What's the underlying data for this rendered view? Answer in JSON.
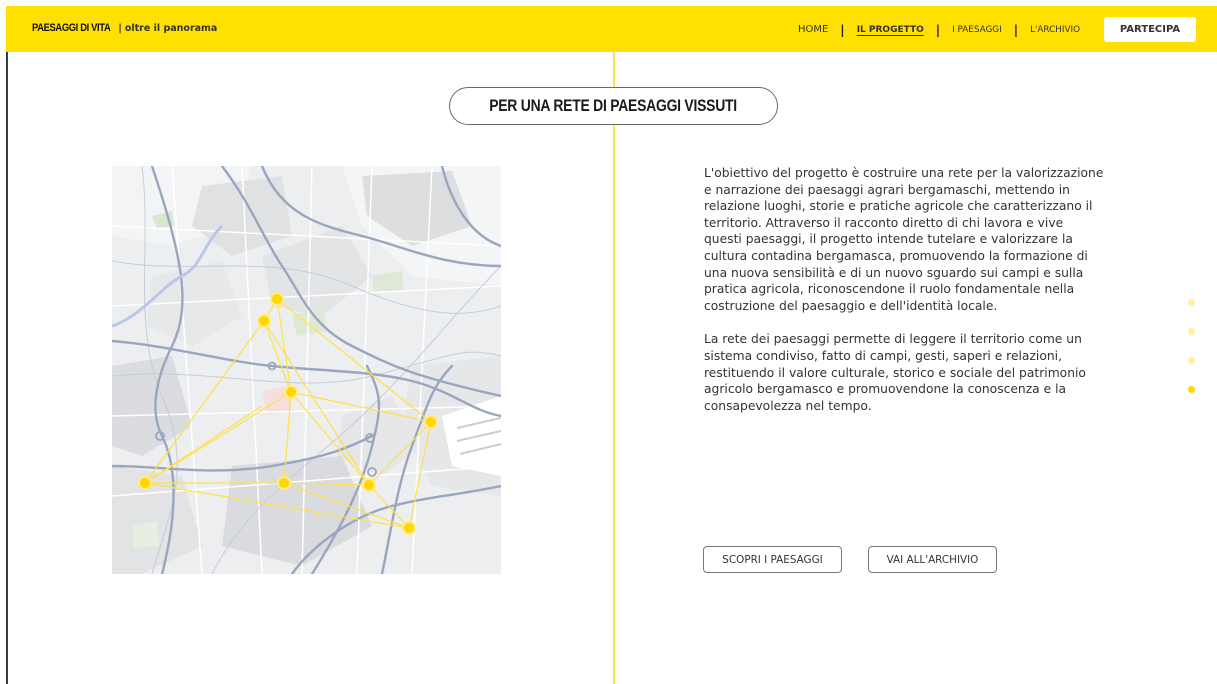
{
  "header": {
    "brand_name": "PAESAGGI DI VITA",
    "brand_separator": "|",
    "brand_tagline": "oltre il panorama",
    "nav": [
      {
        "label": "HOME"
      },
      {
        "label": "IL PROGETTO"
      },
      {
        "label": "I PAESAGGI"
      },
      {
        "label": "L'ARCHIVIO"
      }
    ],
    "nav_separator": "|",
    "cta_label": "PARTECIPA"
  },
  "section": {
    "title": "PER UNA RETE DI PAESAGGI VISSUTI",
    "paragraphs": [
      "L'obiettivo del progetto è costruire una rete per la valorizzazione e narrazione dei paesaggi agrari bergamaschi, mettendo in relazione luoghi, storie e pratiche agricole che caratterizzano il territorio. Attraverso il racconto diretto di chi lavora e vive questi paesaggi, il progetto intende tutelare e valorizzare la cultura contadina bergamasca, promuovendo la formazione di una nuova sensibilità e di un nuovo sguardo sui campi e sulla pratica agricola, riconoscendone il ruolo fondamentale nella costruzione del paesaggio e dell'identità locale.",
      "La rete dei paesaggi permette di leggere il territorio come un sistema condiviso, fatto di campi, gesti, saperi e relazioni, restituendo il valore culturale, storico e sociale del patrimonio agricolo bergamasco e promuovendone la conoscenza e la consapevolezza nel tempo."
    ],
    "buttons": [
      {
        "label": "SCOPRI I PAESAGGI"
      },
      {
        "label": "VAI ALL'ARCHIVIO"
      }
    ]
  },
  "map": {
    "node_color": "#ffd700",
    "link_color": "#ffe14a"
  },
  "pager": {
    "total": 4,
    "active_index": 3
  },
  "colors": {
    "brand_yellow": "#ffe000",
    "accent_line": "#ffe14a"
  }
}
